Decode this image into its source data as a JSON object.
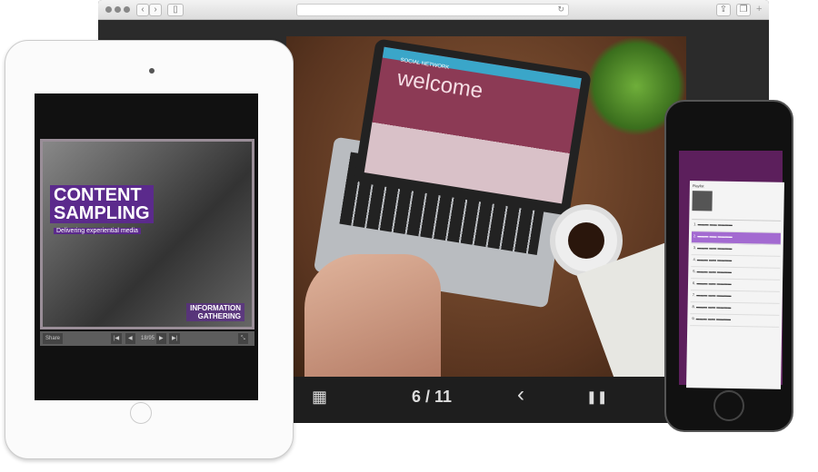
{
  "browser": {
    "icons": [
      "close-dot",
      "minimize-dot",
      "zoom-dot",
      "back-icon",
      "forward-icon",
      "sidebar-icon",
      "reload-icon",
      "share-icon",
      "tabs-icon",
      "new-tab-icon"
    ]
  },
  "laptop_screen": {
    "header": "SOCIAL NETWORK",
    "title": "welcome",
    "accent": "#3aa6c9",
    "primary": "#8c3a55"
  },
  "viewer_controls": {
    "grid_icon": "▦",
    "page_counter": "6 / 11",
    "prev_icon": "‹",
    "pause_icon": "❚❚",
    "next_icon": "›"
  },
  "tablet": {
    "title_line1": "CONTENT",
    "title_line2": "SAMPLING",
    "subtitle": "Delivering experiential media",
    "info_line1": "INFORMATION",
    "info_line2": "GATHERING",
    "share_label": "Share",
    "page_counter": "18/95",
    "accent": "#5b2a8c"
  },
  "phone": {
    "playlist_title": "Playlist",
    "track_count": 9,
    "active_track": 2,
    "accent": "#a36ad1",
    "background": "#5c1f5c"
  }
}
